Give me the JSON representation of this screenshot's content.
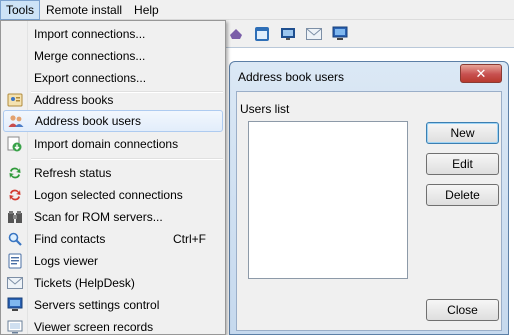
{
  "menubar": {
    "tools": "Tools",
    "remote_install": "Remote install",
    "help": "Help"
  },
  "tools_menu": {
    "items": [
      {
        "label": "Import connections...",
        "icon": "none"
      },
      {
        "label": "Merge connections...",
        "icon": "none"
      },
      {
        "label": "Export connections...",
        "icon": "none"
      },
      {
        "label": "Address books",
        "icon": "address-book-icon"
      },
      {
        "label": "Address book users",
        "icon": "users-icon",
        "highlighted": true
      },
      {
        "label": "Import domain connections",
        "icon": "domain-import-icon"
      },
      {
        "label": "Refresh status",
        "icon": "refresh-icon"
      },
      {
        "label": "Logon selected connections",
        "icon": "logon-icon"
      },
      {
        "label": "Scan for ROM servers...",
        "icon": "scan-icon"
      },
      {
        "label": "Find contacts",
        "icon": "magnifier-icon",
        "shortcut": "Ctrl+F"
      },
      {
        "label": "Logs viewer",
        "icon": "logs-icon"
      },
      {
        "label": "Tickets (HelpDesk)",
        "icon": "envelope-icon"
      },
      {
        "label": "Servers settings control",
        "icon": "monitor-icon"
      },
      {
        "label": "Viewer screen records",
        "icon": "screen-record-icon"
      }
    ]
  },
  "toolbar_icons": [
    "app-icon",
    "window-icon",
    "screen-icon",
    "mail-icon",
    "monitor-icon"
  ],
  "dialog": {
    "title": "Address book users",
    "close_label": "✕",
    "users_list_label": "Users list",
    "buttons": {
      "new": "New",
      "edit": "Edit",
      "delete": "Delete",
      "close": "Close"
    }
  },
  "colors": {
    "highlight_border": "#aecbf0",
    "dialog_frame": "#c6d9ee",
    "close_red": "#c75050"
  }
}
